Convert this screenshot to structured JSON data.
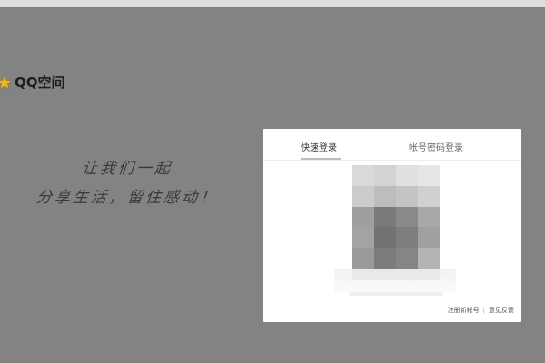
{
  "brand": {
    "logo_icon": "star-icon",
    "name": "QQ空间"
  },
  "slogan": {
    "line1": "让我们一起",
    "line2": "分享生活，留住感动！"
  },
  "login": {
    "tabs": [
      {
        "label": "快速登录",
        "active": true
      },
      {
        "label": "帐号密码登录",
        "active": false
      }
    ],
    "qr_icon": "qr-code-blurred",
    "footer": {
      "register_label": "注册新帐号",
      "separator": "|",
      "feedback_label": "意见反馈"
    }
  },
  "colors": {
    "overlay": "#838383",
    "panel": "#ffffff",
    "star": "#e8b82e"
  }
}
